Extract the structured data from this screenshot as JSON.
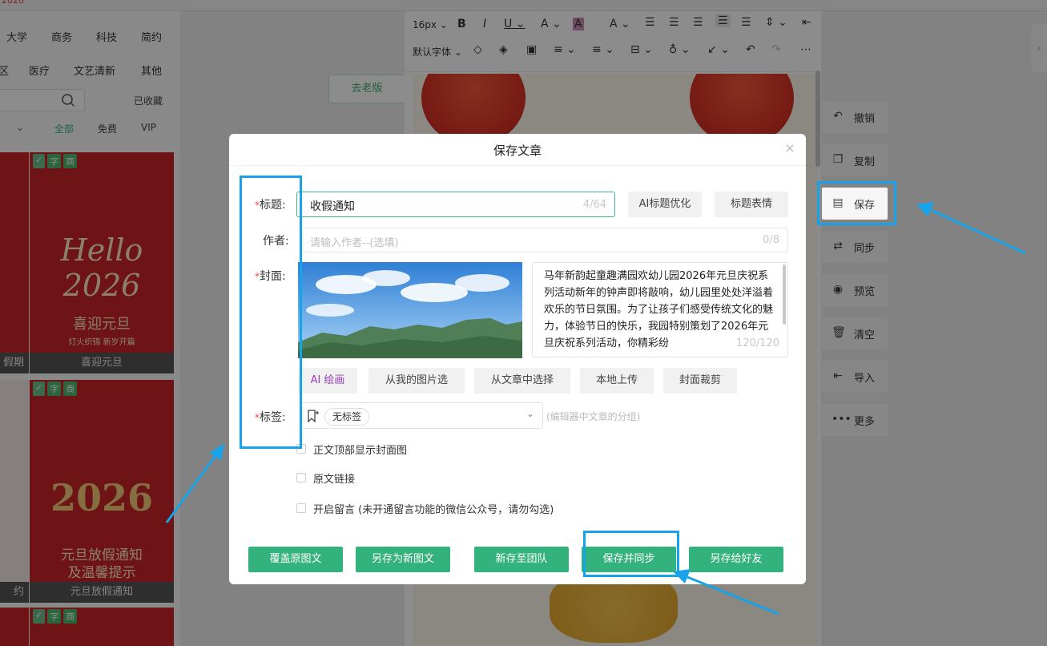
{
  "header": {
    "logo_text": "2026"
  },
  "left_panel": {
    "categories_row1": [
      "大学",
      "商务",
      "科技",
      "简约"
    ],
    "categories_row2": [
      "区",
      "医疗",
      "文艺清新",
      "其他"
    ],
    "favorites_label": "已收藏",
    "filters": [
      "全部",
      "免费",
      "VIP"
    ],
    "templates": [
      {
        "caption": "假期",
        "title": ""
      },
      {
        "caption": "喜迎元旦",
        "title": "Hello 2026",
        "subtitle": "喜迎元旦",
        "tagline": "灯火织锦 新岁开篇"
      },
      {
        "caption": "约",
        "title": ""
      },
      {
        "caption": "元旦放假通知",
        "title": "2026",
        "subtitle": "元旦放假通知",
        "tagline": "及温馨提示"
      }
    ],
    "badges": [
      "字",
      "商"
    ]
  },
  "mid": {
    "old_version_button": "去老版"
  },
  "editor": {
    "font_size": "16px",
    "font_family": "默认字体"
  },
  "side_actions": [
    {
      "label": "撤销",
      "icon": "undo-icon"
    },
    {
      "label": "复制",
      "icon": "copy-icon"
    },
    {
      "label": "保存",
      "icon": "save-icon"
    },
    {
      "label": "同步",
      "icon": "sync-icon"
    },
    {
      "label": "预览",
      "icon": "eye-icon"
    },
    {
      "label": "清空",
      "icon": "trash-icon"
    },
    {
      "label": "导入",
      "icon": "import-icon"
    },
    {
      "label": "更多",
      "icon": "more-icon"
    }
  ],
  "dialog": {
    "title": "保存文章",
    "fields": {
      "title_label": "标题:",
      "title_value": "收假通知",
      "title_count": "4/64",
      "ai_optimize": "AI标题优化",
      "title_emoji": "标题表情",
      "author_label": "作者:",
      "author_placeholder": "请输入作者--(选填)",
      "author_count": "0/8",
      "cover_label": "封面:",
      "summary": "马年新韵起童趣满园欢幼儿园2026年元旦庆祝系列活动新年的钟声即将敲响，幼儿园里处处洋溢着欢乐的节日氛围。为了让孩子们感受传统文化的魅力，体验节日的快乐，我园特别策划了2026年元旦庆祝系列活动，你精彩纷",
      "summary_count": "120/120",
      "tag_label": "标签:",
      "tag_value": "无标签",
      "tag_hint": "(编辑器中文章的分组)"
    },
    "cover_buttons": [
      "AI 绘画",
      "从我的图片选",
      "从文章中选择",
      "本地上传",
      "封面裁剪"
    ],
    "checkboxes": [
      "正文顶部显示封面图",
      "原文链接",
      "开启留言 (未开通留言功能的微信公众号，请勿勾选)"
    ],
    "actions": [
      "覆盖原图文",
      "另存为新图文",
      "新存至团队",
      "保存并同步",
      "另存给好友"
    ]
  },
  "colors": {
    "primary": "#34b27e",
    "highlight": "#17a3ea",
    "required": "#e5484d",
    "ai_purple": "#9b3fb5"
  }
}
